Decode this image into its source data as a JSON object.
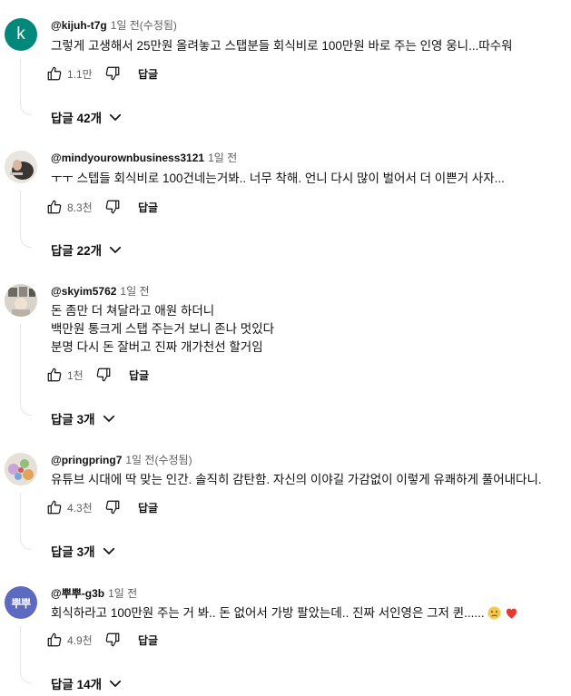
{
  "comments": [
    {
      "avatar_letter": "k",
      "author": "@kijuh-t7g",
      "time": "1일 전(수정됨)",
      "lines": [
        "그렇게 고생해서 25만원 올려놓고 스탭분들 회식비로 100만원 바로 주는 인영 웅니...따수워"
      ],
      "likes": "1.1만",
      "reply_label": "답글",
      "replies_label": "답글 42개"
    },
    {
      "author": "@mindyourownbusiness3121",
      "time": "1일 전",
      "lines": [
        "ㅜㅜ 스텝들 회식비로 100건네는거봐.. 너무 착해. 언니 다시 많이 벌어서 더 이쁜거 사자..."
      ],
      "likes": "8.3천",
      "reply_label": "답글",
      "replies_label": "답글 22개"
    },
    {
      "author": "@skyim5762",
      "time": "1일 전",
      "lines": [
        "돈 좀만 더 쳐달라고 애원 하더니",
        "백만원 통크게 스탭 주는거 보니 존나 멋있다",
        "분명 다시 돈 잘버고 진짜 개가천선 할거임"
      ],
      "likes": "1천",
      "reply_label": "답글",
      "replies_label": "답글 3개"
    },
    {
      "author": "@pringpring7",
      "time": "1일 전(수정됨)",
      "lines": [
        "유튜브 시대에 딱 맞는 인간. 솔직히 감탄함. 자신의 이야길 가감없이 이렇게 유쾌하게  풀어내다니."
      ],
      "likes": "4.3천",
      "reply_label": "답글",
      "replies_label": "답글 3개"
    },
    {
      "avatar_text": "뿌뿌",
      "author": "@뿌뿌-g3b",
      "time": "1일 전",
      "lines": [
        "회식하라고 100만원 주는 거 봐.. 돈 없어서 가방 팔았는데.. 진짜 서인영은 그저 퀸......"
      ],
      "likes": "4.9천",
      "reply_label": "답글",
      "replies_label": "답글 14개"
    }
  ],
  "colors": {
    "avatar_k": "#00897b",
    "avatar_ppu": "#5c6bc0",
    "text_primary": "#0f0f0f",
    "text_secondary": "#606060",
    "thread_line": "#e5e5e5"
  },
  "icons": {
    "like": "thumb-up-icon",
    "dislike": "thumb-down-icon",
    "expand": "chevron-down-icon",
    "emoji_sad": "crying-face-emoji",
    "emoji_heart": "red-heart-emoji"
  }
}
